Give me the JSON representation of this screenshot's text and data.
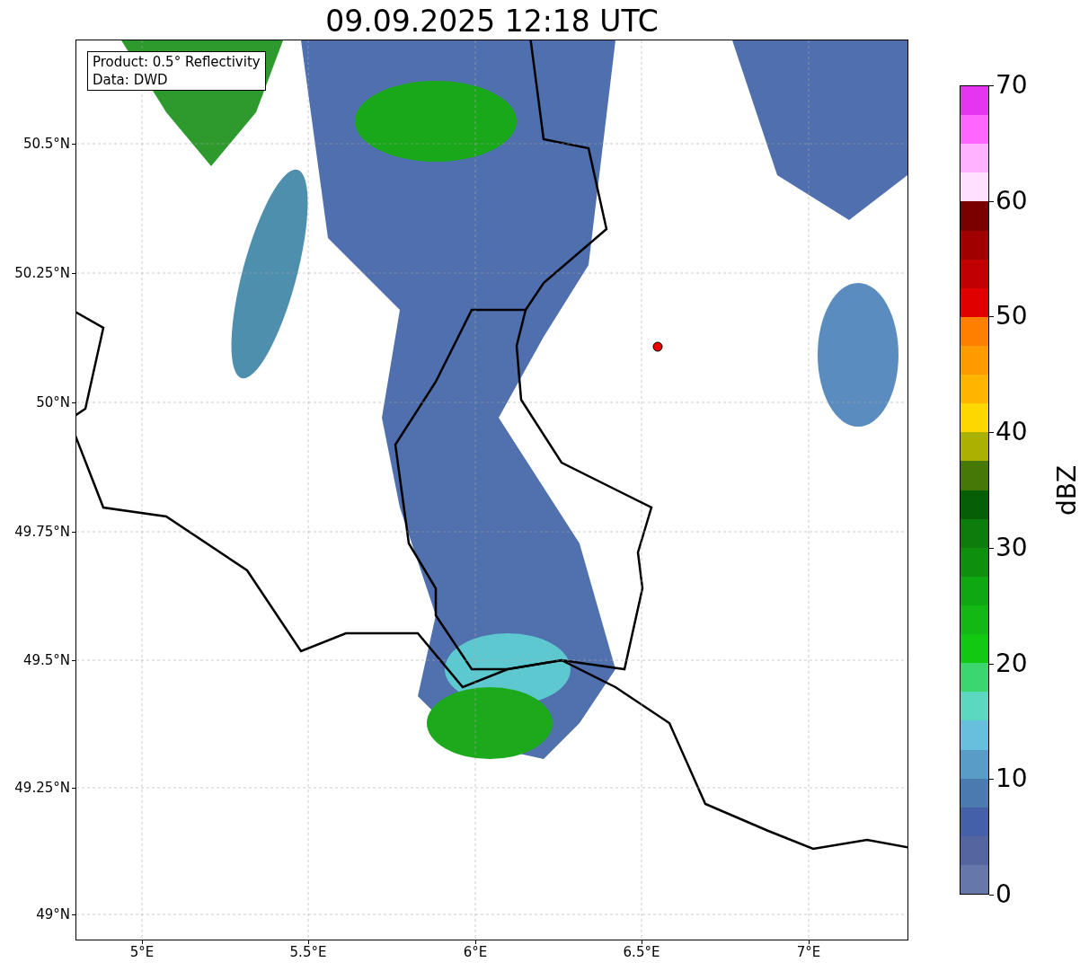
{
  "title": "09.09.2025 12:18 UTC",
  "legend": [
    "Product: 0.5° Reflectivity",
    "Data: DWD"
  ],
  "lat_ticks": [
    "50.5°N",
    "50.25°N",
    "50°N",
    "49.75°N",
    "49.5°N",
    "49.25°N",
    "49°N"
  ],
  "lon_ticks": [
    "5°E",
    "5.5°E",
    "6°E",
    "6.5°E",
    "7°E"
  ],
  "colorbar": {
    "label": "dBZ",
    "ticks": [
      "70",
      "60",
      "50",
      "40",
      "30",
      "20",
      "10",
      "0"
    ],
    "segments": [
      {
        "color": "#e535f0"
      },
      {
        "color": "#ff66ff"
      },
      {
        "color": "#ffb3ff"
      },
      {
        "color": "#ffe0ff"
      },
      {
        "color": "#7a0000"
      },
      {
        "color": "#a00000"
      },
      {
        "color": "#c00000"
      },
      {
        "color": "#e00000"
      },
      {
        "color": "#ff8000"
      },
      {
        "color": "#ff9a00"
      },
      {
        "color": "#ffb400"
      },
      {
        "color": "#ffd700"
      },
      {
        "color": "#acb000"
      },
      {
        "color": "#467808"
      },
      {
        "color": "#065e06"
      },
      {
        "color": "#0c7c0c"
      },
      {
        "color": "#0e900e"
      },
      {
        "color": "#10a810"
      },
      {
        "color": "#14b814"
      },
      {
        "color": "#12c812"
      },
      {
        "color": "#3cd670"
      },
      {
        "color": "#5cd8c0"
      },
      {
        "color": "#66c0dd"
      },
      {
        "color": "#5a9cc8"
      },
      {
        "color": "#4a7ab0"
      },
      {
        "color": "#4460a8"
      },
      {
        "color": "#5366a0"
      },
      {
        "color": "#6677aa"
      }
    ]
  }
}
